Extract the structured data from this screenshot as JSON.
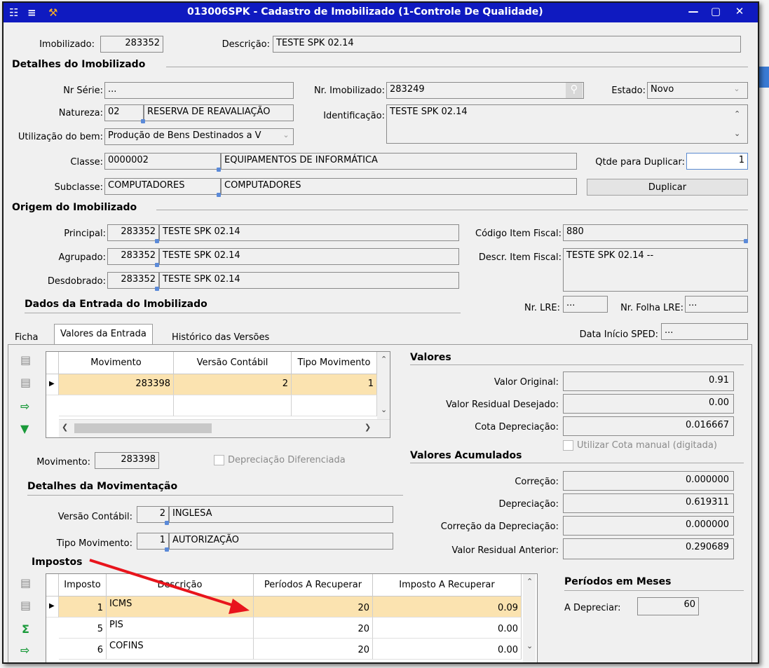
{
  "window": {
    "title": "013006SPK - Cadastro de Imobilizado (1-Controle De Qualidade)"
  },
  "header": {
    "imobilizado_label": "Imobilizado:",
    "imobilizado_value": "283352",
    "descricao_label": "Descrição:",
    "descricao_value": "TESTE SPK 02.14"
  },
  "detalhes": {
    "title": "Detalhes do Imobilizado",
    "nr_serie_label": "Nr Série:",
    "nr_serie_value": "...",
    "nr_imob_label": "Nr. Imobilizado:",
    "nr_imob_value": "283249",
    "estado_label": "Estado:",
    "estado_value": "Novo",
    "natureza_label": "Natureza:",
    "natureza_code": "02",
    "natureza_desc": "RESERVA DE REAVALIAÇÃO",
    "identificacao_label": "Identificação:",
    "identificacao_value": "TESTE SPK 02.14",
    "utilizacao_label": "Utilização do bem:",
    "utilizacao_value": "Produção de Bens Destinados a V",
    "classe_label": "Classe:",
    "classe_code": "0000002",
    "classe_desc": "EQUIPAMENTOS DE INFORMÁTICA",
    "qtde_label": "Qtde para Duplicar:",
    "qtde_value": "1",
    "subclasse_label": "Subclasse:",
    "subclasse_code": "COMPUTADORES",
    "subclasse_desc": "COMPUTADORES",
    "duplicar_label": "Duplicar"
  },
  "origem": {
    "title": "Origem do Imobilizado",
    "principal_label": "Principal:",
    "principal_code": "283352",
    "principal_desc": "TESTE SPK 02.14",
    "agrupado_label": "Agrupado:",
    "agrupado_code": "283352",
    "agrupado_desc": "TESTE SPK 02.14",
    "desdobrado_label": "Desdobrado:",
    "desdobrado_code": "283352",
    "desdobrado_desc": "TESTE SPK 02.14",
    "cod_item_label": "Código Item Fiscal:",
    "cod_item_value": "880",
    "descr_item_label": "Descr. Item Fiscal:",
    "descr_item_value": "TESTE SPK 02.14 --"
  },
  "entrada": {
    "title": "Dados da Entrada do Imobilizado",
    "nr_lre_label": "Nr. LRE:",
    "nr_lre_value": "...",
    "nr_folha_label": "Nr. Folha LRE:",
    "nr_folha_value": "...",
    "data_sped_label": "Data Início SPED:",
    "data_sped_value": "..."
  },
  "tabs": [
    {
      "label": "Ficha"
    },
    {
      "label": "Valores da Entrada"
    },
    {
      "label": "Histórico das Versões"
    }
  ],
  "mov_grid": {
    "headers": [
      "Movimento",
      "Versão Contábil",
      "Tipo Movimento"
    ],
    "rows": [
      [
        "283398",
        "2",
        "1"
      ]
    ]
  },
  "movimento": {
    "label": "Movimento:",
    "value": "283398",
    "depr_dif_label": "Depreciação Diferenciada"
  },
  "detalhes_mov": {
    "title": "Detalhes da Movimentação",
    "versao_label": "Versão Contábil:",
    "versao_code": "2",
    "versao_desc": "INGLESA",
    "tipo_label": "Tipo Movimento:",
    "tipo_code": "1",
    "tipo_desc": "AUTORIZAÇÃO"
  },
  "valores": {
    "title": "Valores",
    "original_label": "Valor Original:",
    "original_value": "0.91",
    "residual_label": "Valor Residual Desejado:",
    "residual_value": "0.00",
    "cota_label": "Cota Depreciação:",
    "cota_value": "0.016667",
    "cota_manual_label": "Utilizar Cota manual (digitada)"
  },
  "acumulados": {
    "title": "Valores Acumulados",
    "correcao_label": "Correção:",
    "correcao_value": "0.000000",
    "depreciacao_label": "Depreciação:",
    "depreciacao_value": "0.619311",
    "corr_depr_label": "Correção da Depreciação:",
    "corr_depr_value": "0.000000",
    "res_ant_label": "Valor Residual Anterior:",
    "res_ant_value": "0.290689"
  },
  "impostos": {
    "title": "Impostos",
    "headers": [
      "Imposto",
      "Descrição",
      "Períodos A Recuperar",
      "Imposto A Recuperar"
    ],
    "rows": [
      {
        "code": "1",
        "desc": "ICMS",
        "periodos": "20",
        "valor": "0.09"
      },
      {
        "code": "5",
        "desc": "PIS",
        "periodos": "20",
        "valor": "0.00"
      },
      {
        "code": "6",
        "desc": "COFINS",
        "periodos": "20",
        "valor": "0.00"
      }
    ]
  },
  "periodos": {
    "title": "Períodos em Meses",
    "depreciar_label": "A Depreciar:",
    "depreciar_value": "60"
  },
  "colors": {
    "titlebar": "#0f1ac0",
    "selected_row": "#fbe3b0",
    "annotation_arrow": "#e8141c"
  }
}
